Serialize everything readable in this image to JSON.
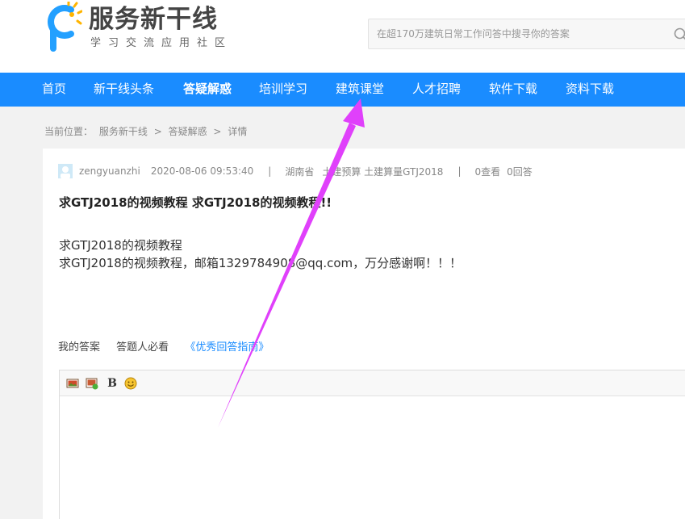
{
  "brand": {
    "name": "服务新干线",
    "slogan": "学习交流应用社区"
  },
  "search": {
    "placeholder": "在超170万建筑日常工作问答中搜寻你的答案"
  },
  "nav": {
    "items": [
      {
        "label": "首页"
      },
      {
        "label": "新干线头条"
      },
      {
        "label": "答疑解惑",
        "active": true
      },
      {
        "label": "培训学习"
      },
      {
        "label": "建筑课堂"
      },
      {
        "label": "人才招聘"
      },
      {
        "label": "软件下载"
      },
      {
        "label": "资料下载"
      }
    ]
  },
  "breadcrumb": {
    "prefix": "当前位置：",
    "items": [
      "服务新干线",
      "答疑解惑",
      "详情"
    ],
    "separator": ">"
  },
  "question": {
    "username": "zengyuanzhi",
    "datetime": "2020-08-06 09:53:40",
    "divider": "|",
    "location": "湖南省",
    "tags": "土建预算 土建算量GTJ2018",
    "views": "0查看",
    "answers": "0回答",
    "title": "求GTJ2018的视频教程 求GTJ2018的视频教程!!",
    "body_line1": "求GTJ2018的视频教程",
    "body_line2": "求GTJ2018的视频教程，邮箱1329784908@qq.com，万分感谢啊！！！"
  },
  "answer": {
    "my_answer_label": "我的答案",
    "must_read_label": "答题人必看",
    "guide_link": "《优秀回答指南》"
  },
  "editor": {
    "bold_label": "B"
  },
  "colors": {
    "brand_blue": "#1a8cff",
    "annotation_arrow": "#e040fb"
  },
  "icons": {
    "logo": "brand-logo-icon",
    "search": "search-icon",
    "avatar": "user-avatar-icon",
    "image": "insert-image-icon",
    "video": "insert-video-icon",
    "emoji": "emoji-icon",
    "arrow": "annotation-arrow"
  }
}
